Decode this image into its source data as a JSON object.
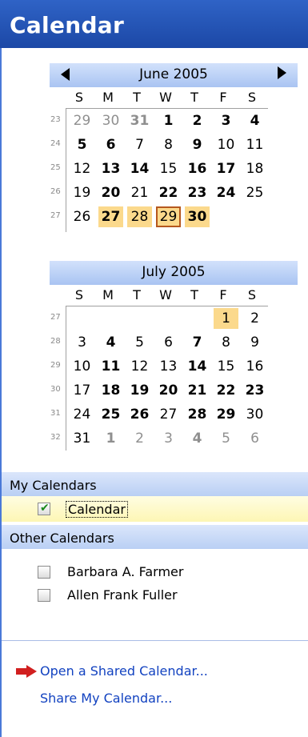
{
  "header": {
    "title": "Calendar"
  },
  "dow": [
    "S",
    "M",
    "T",
    "W",
    "T",
    "F",
    "S"
  ],
  "june": {
    "title": "June 2005",
    "weeks": [
      23,
      24,
      25,
      26,
      27
    ],
    "days": [
      [
        "29",
        "30",
        "31",
        "1",
        "2",
        "3",
        "4"
      ],
      [
        "5",
        "6",
        "7",
        "8",
        "9",
        "10",
        "11"
      ],
      [
        "12",
        "13",
        "14",
        "15",
        "16",
        "17",
        "18"
      ],
      [
        "19",
        "20",
        "21",
        "22",
        "23",
        "24",
        "25"
      ],
      [
        "26",
        "27",
        "28",
        "29",
        "30",
        "",
        ""
      ]
    ]
  },
  "july": {
    "title": "July 2005",
    "weeks": [
      27,
      28,
      29,
      30,
      31,
      32
    ],
    "days": [
      [
        "",
        "",
        "",
        "",
        "",
        "1",
        "2"
      ],
      [
        "3",
        "4",
        "5",
        "6",
        "7",
        "8",
        "9"
      ],
      [
        "10",
        "11",
        "12",
        "13",
        "14",
        "15",
        "16"
      ],
      [
        "17",
        "18",
        "19",
        "20",
        "21",
        "22",
        "23"
      ],
      [
        "24",
        "25",
        "26",
        "27",
        "28",
        "29",
        "30"
      ],
      [
        "31",
        "1",
        "2",
        "3",
        "4",
        "5",
        "6"
      ]
    ]
  },
  "my_calendars": {
    "label": "My Calendars",
    "items": [
      {
        "label": "Calendar",
        "checked": true
      }
    ]
  },
  "other_calendars": {
    "label": "Other Calendars",
    "items": [
      {
        "label": "Barbara A. Farmer",
        "checked": false
      },
      {
        "label": "Allen Frank Fuller",
        "checked": false
      }
    ]
  },
  "links": {
    "open_shared": "Open a Shared Calendar...",
    "share_mine": "Share My Calendar..."
  },
  "colors": {
    "header": "#2559bd",
    "highlight": "#fbd98c",
    "today_border": "#b5581e",
    "link": "#1242c0"
  }
}
